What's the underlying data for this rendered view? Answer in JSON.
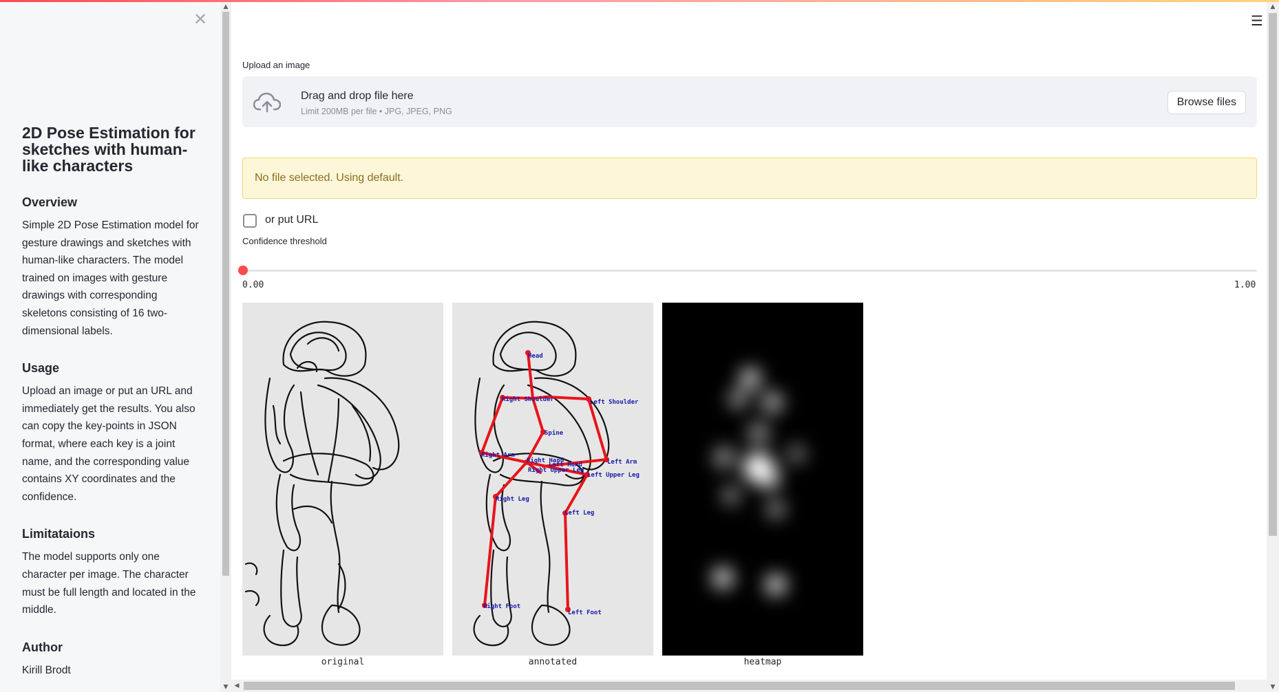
{
  "sidebar": {
    "title": "2D Pose Estimation for sketches with human-like characters",
    "sections": [
      {
        "heading": "Overview",
        "text": "Simple 2D Pose Estimation model for gesture drawings and sketches with human-like characters. The model trained on images with gesture drawings with corresponding skeletons consisting of 16 two-dimensional labels."
      },
      {
        "heading": "Usage",
        "text": "Upload an image or put an URL and immediately get the results. You also can copy the key-points in JSON format, where each key is a joint name, and the corresponding value contains XY coordinates and the confidence."
      },
      {
        "heading": "Limitataions",
        "text": "The model supports only one character per image. The character must be full length and located in the middle."
      },
      {
        "heading": "Author",
        "text": "Kirill Brodt"
      }
    ]
  },
  "main": {
    "upload_label": "Upload an image",
    "uploader": {
      "main_text": "Drag and drop file here",
      "sub_text": "Limit 200MB per file • JPG, JPEG, PNG",
      "button": "Browse files"
    },
    "alert": "No file selected. Using default.",
    "checkbox_label": "or put URL",
    "slider": {
      "label": "Confidence threshold",
      "min_label": "0.00",
      "max_label": "1.00",
      "value": 0.0
    },
    "images": [
      {
        "caption": "original"
      },
      {
        "caption": "annotated"
      },
      {
        "caption": "heatmap"
      }
    ],
    "joint_labels": [
      "Head",
      "Right Shoulder",
      "Left Shoulder",
      "Spine",
      "Right Arm",
      "Left Arm",
      "Right Hand",
      "Left Hand",
      "Right Upper Leg",
      "Left Upper Leg",
      "Right Leg",
      "Left Leg",
      "Right Foot",
      "Left Foot"
    ]
  },
  "colors": {
    "accent": "#ff4b4b",
    "skeleton": "#e8141b",
    "joint_text": "#1a1aa8",
    "alert_bg": "#fdf6d9"
  },
  "icons": {
    "close": "close-icon",
    "menu": "hamburger-menu-icon",
    "upload": "cloud-upload-icon"
  }
}
